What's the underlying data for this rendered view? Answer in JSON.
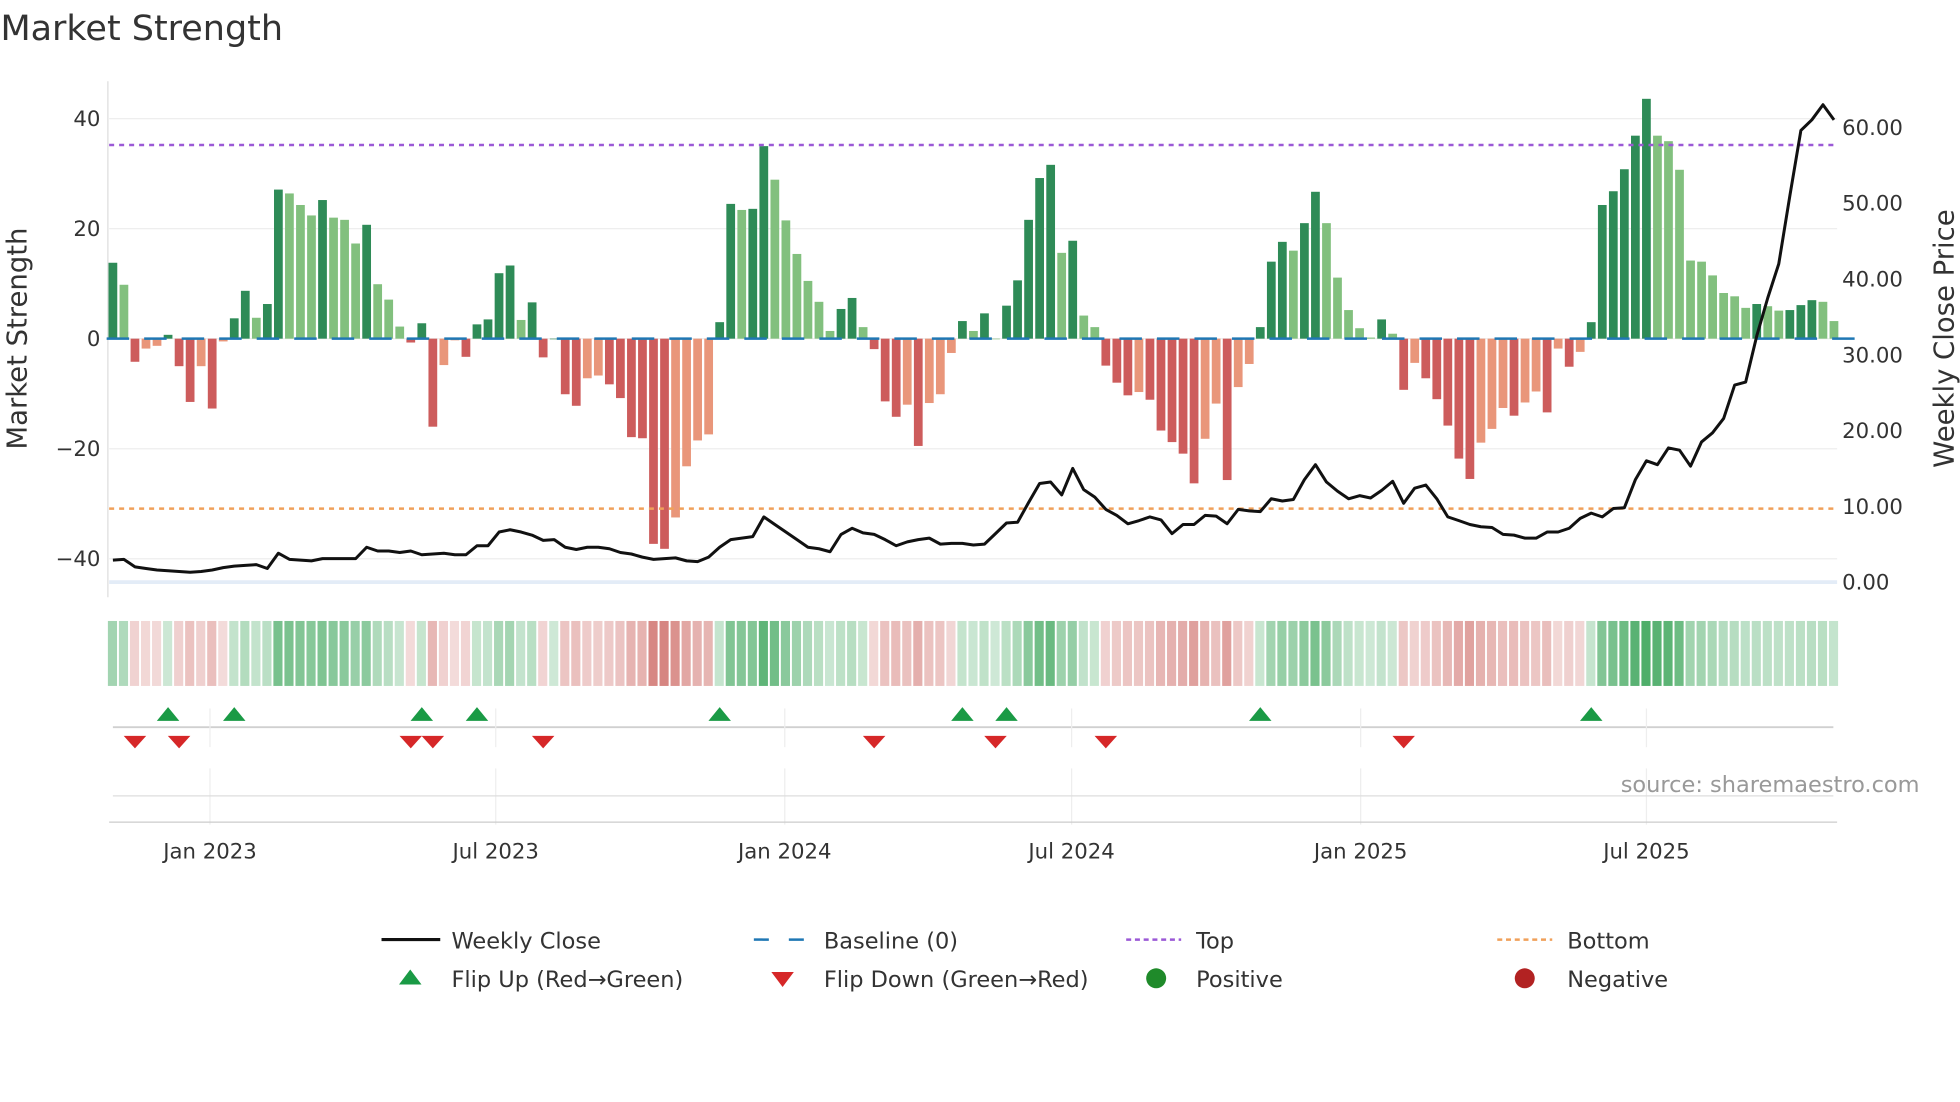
{
  "chart_data": {
    "type": "bar",
    "title": "Market Strength",
    "ylabel": "Market Strength",
    "y2label": "Weekly Close Price",
    "ylim": [
      -47,
      46.8
    ],
    "y2lim": [
      -2,
      66.1
    ],
    "yticks": [
      "40",
      "20",
      "0",
      "−20",
      "−40"
    ],
    "ytick_values": [
      40,
      20,
      0,
      -20,
      -40
    ],
    "y2ticks": [
      "60.00",
      "50.00",
      "40.00",
      "30.00",
      "20.00",
      "10.00",
      "0.00"
    ],
    "y2tick_values": [
      60,
      50,
      40,
      30,
      20,
      10,
      0
    ],
    "xticks": [
      "Jan 2023",
      "Jul 2023",
      "Jan 2024",
      "Jul 2024",
      "Jan 2025",
      "Jul 2025"
    ],
    "xtick_weeks": [
      8.8,
      34.7,
      60.9,
      86.9,
      113.1,
      139.0
    ],
    "top_level": 35.2,
    "bottom_level": -30.9,
    "baseline": 0,
    "strength": [
      13.8,
      9.8,
      -4.2,
      -1.8,
      -1.3,
      0.7,
      -5,
      -11.5,
      -5,
      -12.7,
      -0.5,
      3.7,
      8.7,
      3.8,
      6.3,
      27.1,
      26.4,
      24.3,
      22.4,
      25.2,
      22,
      21.6,
      17.3,
      20.7,
      9.9,
      7.1,
      2.2,
      -0.7,
      2.8,
      -16,
      -4.8,
      -0.3,
      -3.3,
      2.6,
      3.5,
      11.9,
      13.3,
      3.4,
      6.6,
      -3.4,
      0,
      -10.1,
      -12.2,
      -7.2,
      -6.7,
      -8.3,
      -10.8,
      -17.9,
      -18.1,
      -37.3,
      -38.2,
      -32.5,
      -23.2,
      -18.5,
      -17.4,
      3,
      24.5,
      23.4,
      23.6,
      35,
      28.9,
      21.5,
      15.4,
      10.5,
      6.7,
      1.4,
      5.4,
      7.4,
      2.1,
      -1.9,
      -11.4,
      -14.2,
      -12,
      -19.5,
      -11.7,
      -10.1,
      -2.6,
      3.2,
      1.4,
      4.6,
      0,
      6,
      10.6,
      21.6,
      29.2,
      31.6,
      15.6,
      17.8,
      4.2,
      2.1,
      -4.9,
      -8,
      -10.3,
      -9.7,
      -11.1,
      -16.7,
      -18.8,
      -20.9,
      -26.3,
      -18.2,
      -11.8,
      -25.7,
      -8.8,
      -4.6,
      2.1,
      14,
      17.6,
      16,
      21,
      26.7,
      21,
      11.1,
      5.2,
      1.9,
      0.2,
      3.5,
      0.9,
      -9.3,
      -4.4,
      -7.2,
      -11,
      -15.8,
      -21.8,
      -25.5,
      -18.9,
      -16.4,
      -12.6,
      -14,
      -11.6,
      -9.6,
      -13.4,
      -1.8,
      -5.1,
      -2.4,
      3,
      24.3,
      26.8,
      30.8,
      36.9,
      43.6,
      36.9,
      35.9,
      30.7,
      14.2,
      14,
      11.5,
      8.3,
      7.7,
      5.6,
      6.3,
      5.9,
      5.1,
      5.2,
      6.1,
      7,
      6.7,
      3.2
    ],
    "price": [
      2.9,
      3.0,
      2.0,
      1.8,
      1.6,
      1.5,
      1.4,
      1.3,
      1.4,
      1.6,
      1.9,
      2.1,
      2.2,
      2.3,
      1.8,
      3.8,
      3.0,
      2.9,
      2.8,
      3.1,
      3.1,
      3.1,
      3.1,
      4.6,
      4.1,
      4.1,
      3.9,
      4.1,
      3.6,
      3.7,
      3.8,
      3.6,
      3.6,
      4.8,
      4.8,
      6.6,
      6.9,
      6.6,
      6.2,
      5.5,
      5.6,
      4.6,
      4.3,
      4.6,
      4.6,
      4.4,
      3.9,
      3.7,
      3.3,
      3.0,
      3.1,
      3.2,
      2.8,
      2.7,
      3.3,
      4.6,
      5.6,
      5.8,
      6.0,
      8.6,
      7.6,
      6.6,
      5.6,
      4.6,
      4.4,
      4.0,
      6.3,
      7.1,
      6.5,
      6.3,
      5.6,
      4.8,
      5.3,
      5.6,
      5.8,
      5.0,
      5.1,
      5.1,
      4.9,
      5.0,
      6.4,
      7.8,
      7.9,
      10.5,
      13.0,
      13.2,
      11.5,
      15.0,
      12.2,
      11.2,
      9.6,
      8.8,
      7.7,
      8.1,
      8.6,
      8.2,
      6.4,
      7.6,
      7.6,
      8.8,
      8.7,
      7.7,
      9.6,
      9.4,
      9.3,
      11.0,
      10.7,
      10.9,
      13.5,
      15.5,
      13.2,
      12.0,
      11.0,
      11.4,
      11.1,
      12.1,
      13.3,
      10.4,
      12.4,
      12.8,
      11.0,
      8.6,
      8.1,
      7.6,
      7.3,
      7.2,
      6.3,
      6.2,
      5.8,
      5.8,
      6.6,
      6.6,
      7.1,
      8.4,
      9.1,
      8.6,
      9.7,
      9.8,
      13.5,
      16.0,
      15.5,
      17.7,
      17.4,
      15.3,
      18.5,
      19.7,
      21.6,
      26.0,
      26.4,
      32.5,
      37.5,
      42.0,
      51.0,
      59.6,
      61.0,
      63.0,
      61.0
    ],
    "flip_up_weeks": [
      5,
      11,
      28,
      33,
      55,
      77,
      81,
      104,
      134
    ],
    "flip_down_weeks": [
      2,
      6,
      27,
      29,
      39,
      69,
      80,
      90,
      117
    ],
    "legend": {
      "placement": "bottom",
      "items": [
        {
          "label": "Weekly Close",
          "kind": "line"
        },
        {
          "label": "Baseline (0)",
          "kind": "dashed"
        },
        {
          "label": "Top",
          "kind": "dotted-purple"
        },
        {
          "label": "Bottom",
          "kind": "dotted-orange"
        },
        {
          "label": "Flip Up (Red→Green)",
          "kind": "up-triangle"
        },
        {
          "label": "Flip Down (Green→Red)",
          "kind": "down-triangle"
        },
        {
          "label": "Positive",
          "kind": "green-dot"
        },
        {
          "label": "Negative",
          "kind": "red-dot"
        }
      ]
    }
  },
  "source": "source: sharemaestro.com",
  "colors": {
    "strong_pos": "#2e8b57",
    "weak_pos": "#82c07e",
    "strong_neg": "#cd5c5c",
    "weak_neg": "#e9967a",
    "baseline": "#1f77b4",
    "top": "#9b59d6",
    "bottom": "#f0a05a",
    "flip_up": "#1a9a45",
    "flip_down": "#d62728",
    "positive": "#1f8a2a",
    "negative": "#b22222",
    "price": "#111111"
  }
}
